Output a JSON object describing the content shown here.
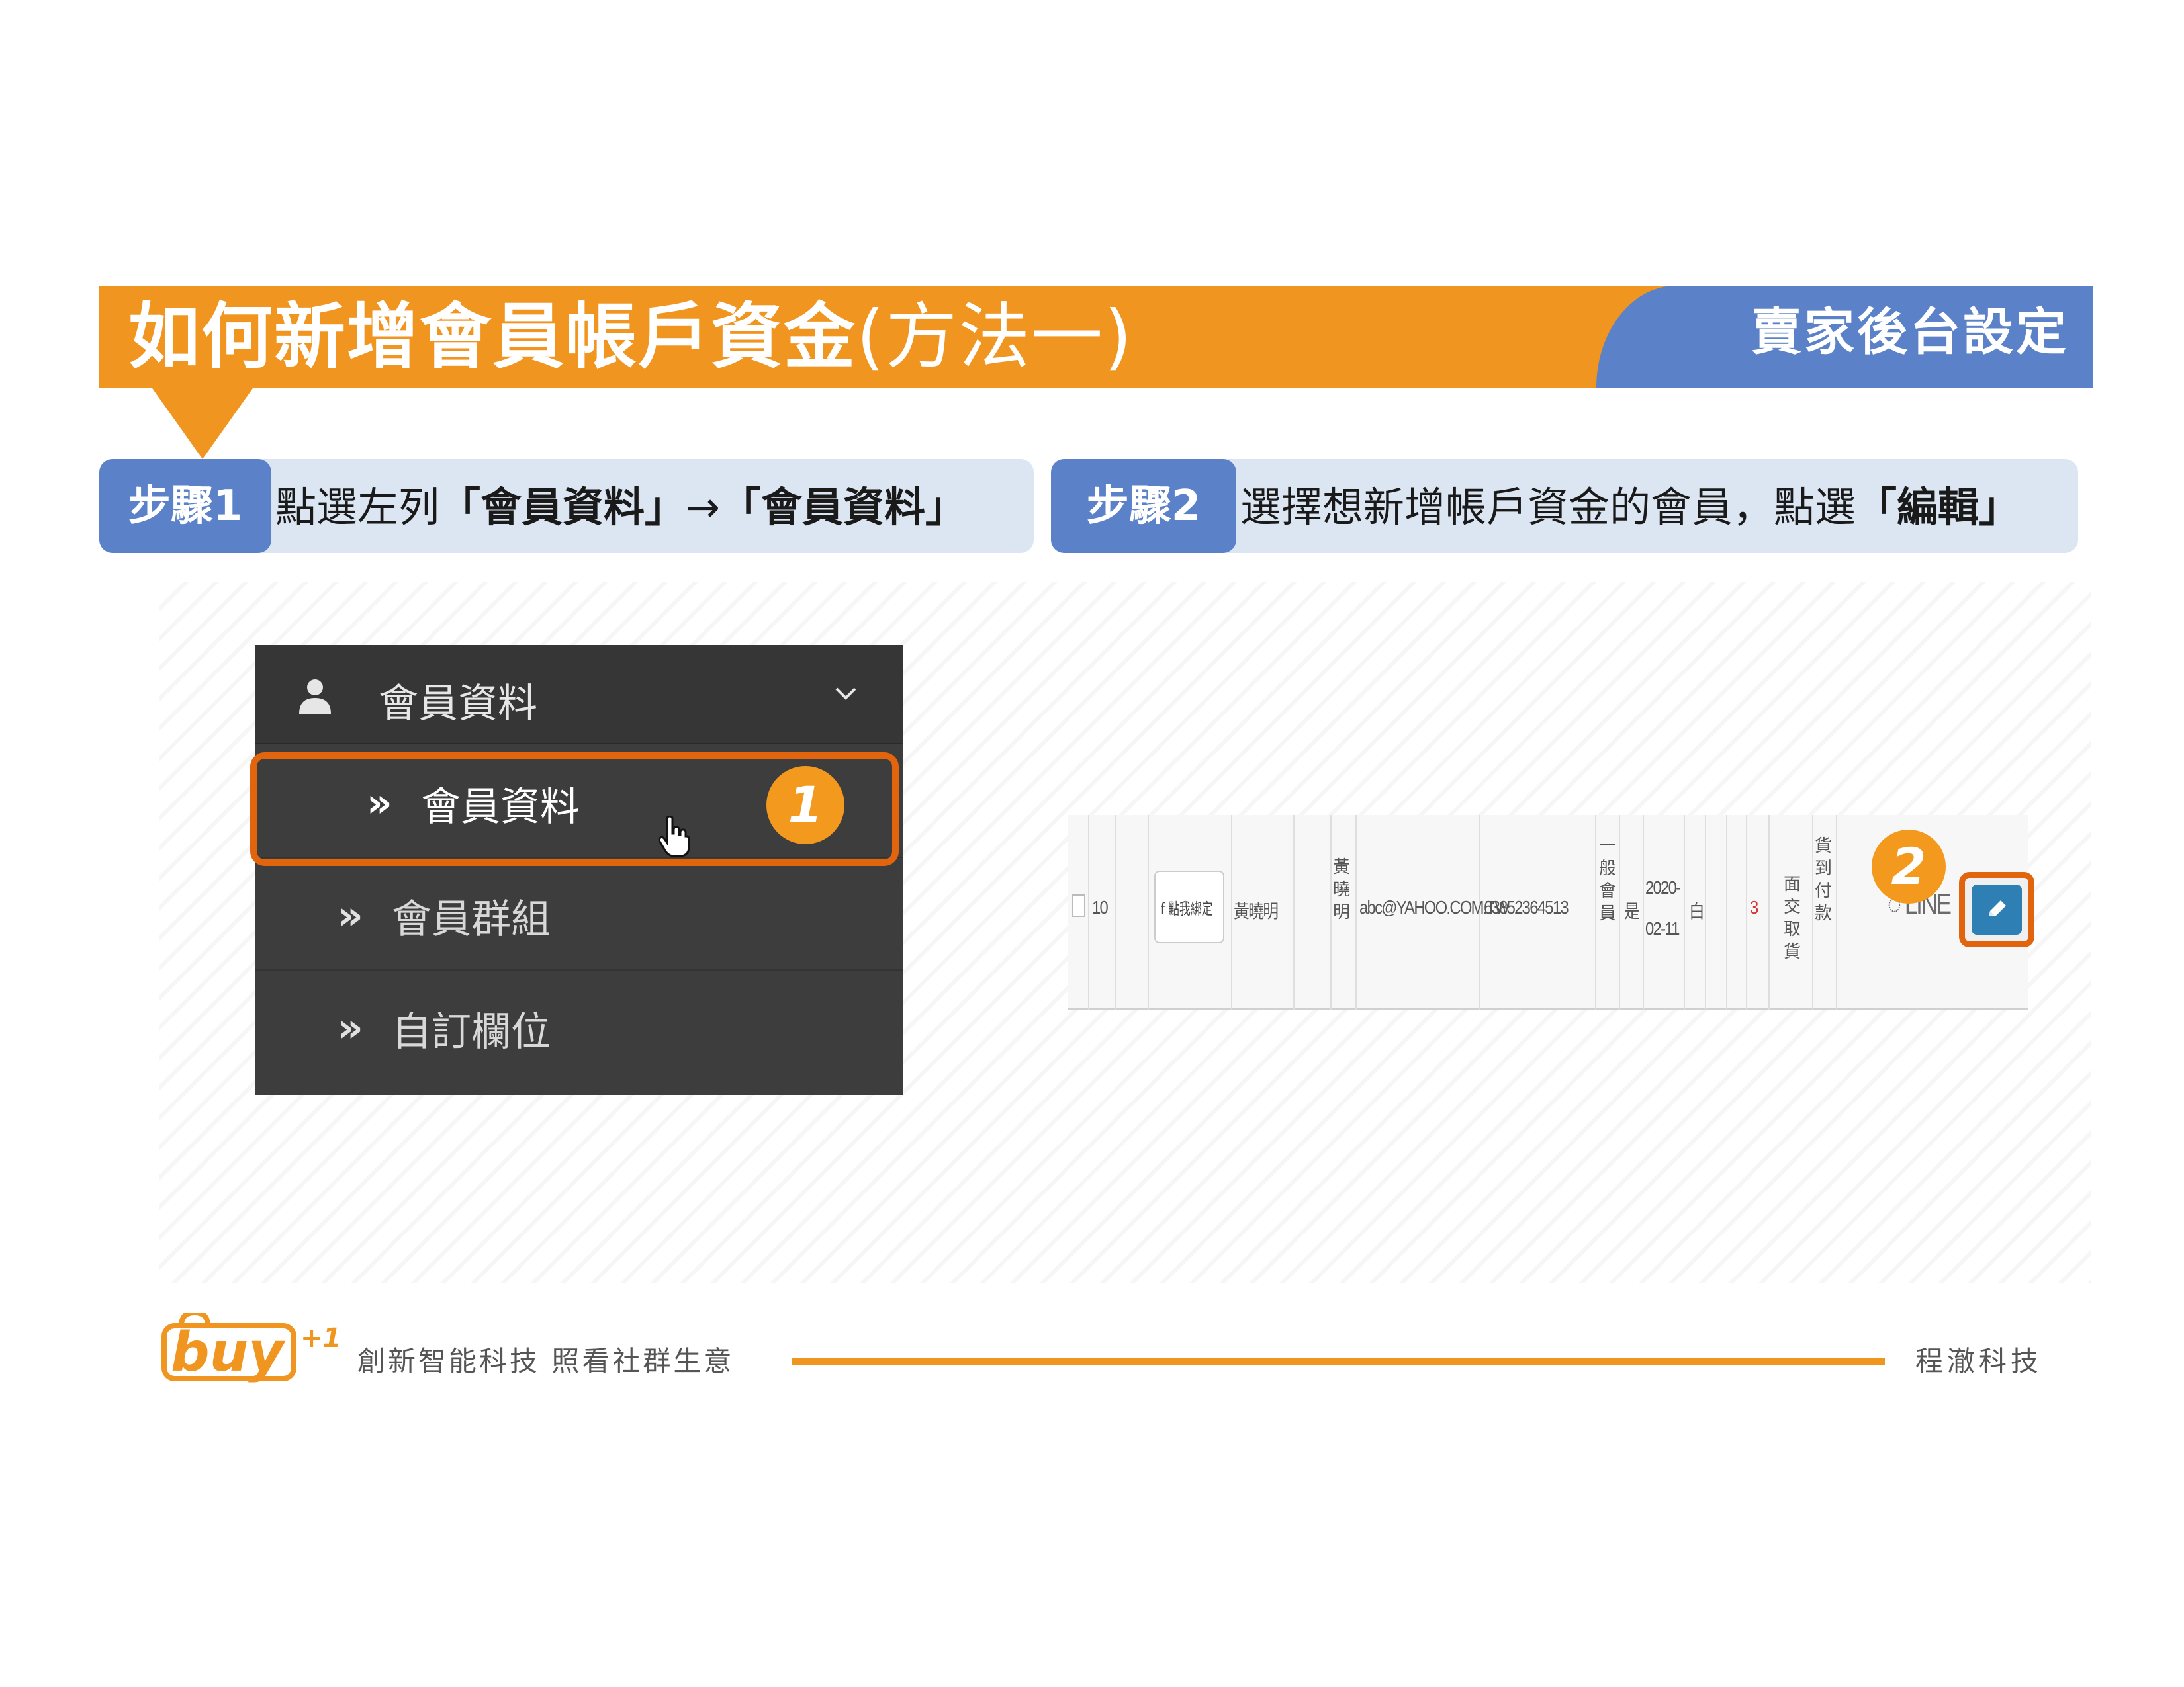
{
  "banner": {
    "title_bold": "如何新增會員帳戶資金",
    "title_light": "(方法一)",
    "tag": "賣家後台設定",
    "colors": {
      "orange": "#f0951f",
      "blue": "#5b82c8"
    }
  },
  "steps": [
    {
      "badge": "步驟1",
      "text_prefix": "點選左列",
      "text_bold1": "「會員資料」",
      "text_arrow": "→",
      "text_bold2": "「會員資料」"
    },
    {
      "badge": "步驟2",
      "text_prefix": "選擇想新增帳戶資金的會員，點選",
      "text_bold": "「編輯」"
    }
  ],
  "menu": {
    "header": {
      "icon": "user-icon",
      "label": "會員資料",
      "chevron": "chevron-down-icon"
    },
    "items": [
      {
        "marker": "»",
        "label": "會員資料",
        "active": true
      },
      {
        "marker": "»",
        "label": "會員群組",
        "active": false
      },
      {
        "marker": "»",
        "label": "自訂欄位",
        "active": false
      }
    ]
  },
  "callouts": {
    "one": "1",
    "two": "2"
  },
  "table_row": {
    "index": "10",
    "fb_button": "f 點我綁定",
    "name": "黃曉明",
    "name_vertical": "黃曉明",
    "email": "abc@YAHOO.COM.TW",
    "phone": "63852364513",
    "member_type": "一般會員",
    "yes": "是",
    "date_line1": "2020-",
    "date_line2": "02-11",
    "white": "白",
    "count": "3",
    "pickup": "面交取貨",
    "cod": "貨到付款",
    "line": "LINE",
    "edit_icon": "pencil-icon"
  },
  "footer": {
    "logo_text": "buy",
    "logo_sup": "+1",
    "slogan": "創新智能科技 照看社群生意",
    "company": "程澈科技"
  }
}
